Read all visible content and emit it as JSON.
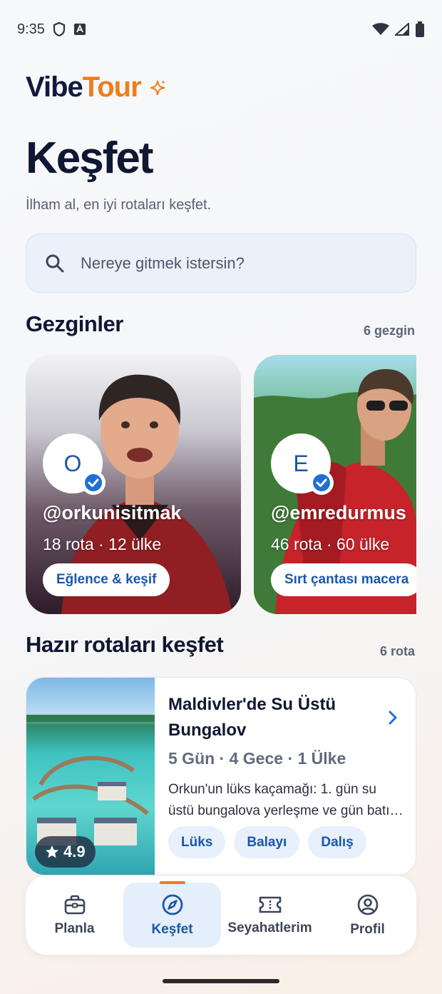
{
  "status": {
    "time": "9:35"
  },
  "brand": {
    "vibe": "Vibe",
    "tour": "Tour"
  },
  "page": {
    "title": "Keşfet",
    "subtitle": "İlham al, en iyi rotaları keşfet."
  },
  "search": {
    "placeholder": "Nereye gitmek istersin?"
  },
  "travelers": {
    "title": "Gezginler",
    "count": "6 gezgin",
    "items": [
      {
        "initial": "O",
        "handle": "@orkunisitmak",
        "stats": "18 rota · 12 ülke",
        "tag": "Eğlence & keşif"
      },
      {
        "initial": "E",
        "handle": "@emredurmus",
        "stats": "46 rota · 60 ülke",
        "tag": "Sırt çantası macera"
      }
    ]
  },
  "routes": {
    "title": "Hazır rotaları keşfet",
    "count": "6 rota",
    "items": [
      {
        "title": "Maldivler'de Su Üstü Bungalov",
        "meta": "5 Gün · 4 Gece · 1 Ülke",
        "description": "Orkun'un lüks kaçamağı: 1. gün su üstü bungalova yerleşme ve gün batı…",
        "rating": "4.9",
        "tags": [
          "Lüks",
          "Balayı",
          "Dalış"
        ]
      }
    ]
  },
  "nav": {
    "items": [
      {
        "label": "Planla",
        "icon": "briefcase-icon"
      },
      {
        "label": "Keşfet",
        "icon": "compass-icon",
        "active": true
      },
      {
        "label": "Seyahatlerim",
        "icon": "ticket-icon"
      },
      {
        "label": "Profil",
        "icon": "profile-icon"
      }
    ]
  },
  "colors": {
    "accent": "#1a57a8",
    "brand_orange": "#ef7d1a",
    "navy": "#0f1733"
  }
}
